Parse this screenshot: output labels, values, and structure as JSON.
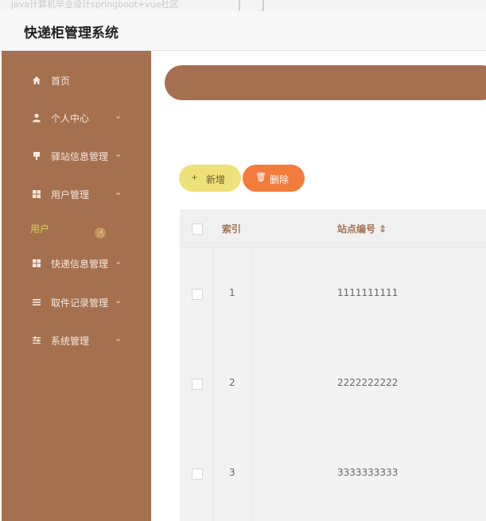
{
  "browser_strip": {
    "ghost_text": "java计算机毕业设计springboot+vue社区"
  },
  "header": {
    "title": "快递柜管理系统"
  },
  "sidebar": {
    "items": [
      {
        "label": "首页",
        "icon": "home-icon",
        "has_chevron": false
      },
      {
        "label": "个人中心",
        "icon": "user-icon",
        "has_chevron": true
      },
      {
        "label": "驿站信息管理",
        "icon": "station-icon",
        "has_chevron": true
      },
      {
        "label": "用户管理",
        "icon": "grid-icon",
        "has_chevron": true
      },
      {
        "label": "快递信息管理",
        "icon": "grid-icon",
        "has_chevron": true
      },
      {
        "label": "取件记录管理",
        "icon": "list-icon",
        "has_chevron": true
      },
      {
        "label": "系统管理",
        "icon": "settings-icon",
        "has_chevron": true
      }
    ],
    "sub_item": {
      "label": "用户"
    },
    "chevron": "⌄"
  },
  "toolbar": {
    "add_label": "新增",
    "add_glyph": "+",
    "delete_label": "删除",
    "delete_glyph": "🗑"
  },
  "table": {
    "columns": [
      "索引",
      "站点编号 ⇕"
    ],
    "rows": [
      {
        "index": "1",
        "station_no": "1111111111"
      },
      {
        "index": "2",
        "station_no": "2222222222"
      },
      {
        "index": "3",
        "station_no": "3333333333"
      }
    ]
  },
  "colors": {
    "sidebar": "#a5704f",
    "accent_add": "#efe17a",
    "accent_delete": "#f27c3c",
    "sub_item": "#d7cf5a"
  }
}
